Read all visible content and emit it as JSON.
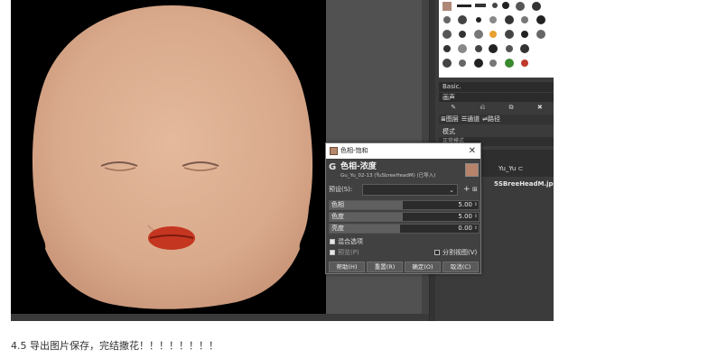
{
  "brush_panel": {
    "brush_name": "Basic.",
    "tags_field": "画声",
    "actions": [
      "✎",
      "⎌",
      "⧉",
      "✖"
    ]
  },
  "dock": {
    "tabs": [
      "≣图层",
      "☰通道",
      "⇌路径"
    ],
    "mode_label": "模式",
    "mode_value": "正常模式",
    "layer_name": "Yu_Yu ⊂",
    "image_name": "5SBreeHeadM.jpg"
  },
  "dialog": {
    "window_title": "色相-饱和",
    "heading": "色相-浓度",
    "subheading": "Gu_Yu_02-13 (ŸuSbreeHeadM) (已导入)",
    "preset_label": "预设(S):",
    "sliders": [
      {
        "label": "色相",
        "value": "5.00",
        "fill": 0.49
      },
      {
        "label": "色度",
        "value": "5.00",
        "fill": 0.49
      },
      {
        "label": "亮度",
        "value": "0.00",
        "fill": 0.47
      }
    ],
    "options": {
      "blend_label": "混合选项",
      "preview_label": "预览(P)",
      "split_label": "分割视图(V)"
    },
    "buttons": {
      "help": "帮助(H)",
      "reset": "重置(R)",
      "ok": "确定(O)",
      "cancel": "取消(C)"
    }
  },
  "caption": "4.5 导出图片保存，完结撒花！！！！！！！！"
}
